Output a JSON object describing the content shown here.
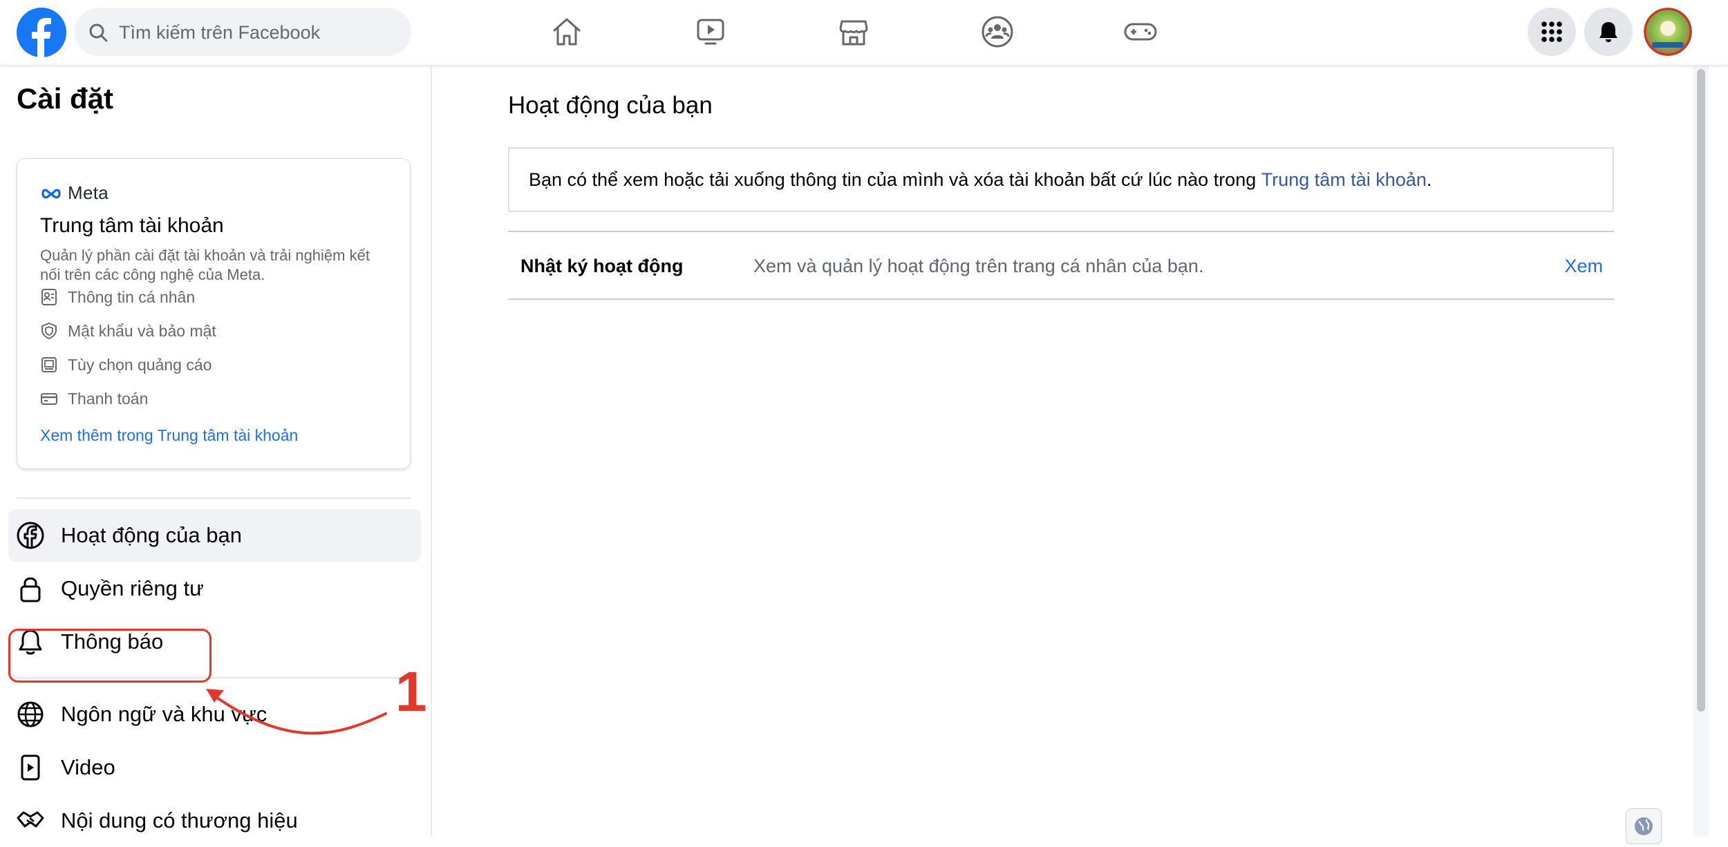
{
  "colors": {
    "facebook_blue": "#1877F2",
    "link_blue": "#216FDB",
    "annotation_red": "#E0382D",
    "active_bg": "#F0F2F5"
  },
  "header": {
    "logo_icon": "facebook-logo-icon",
    "search": {
      "placeholder": "Tìm kiếm trên Facebook",
      "value": ""
    },
    "nav_icons": [
      "home-icon",
      "watch-icon",
      "marketplace-icon",
      "groups-icon",
      "gaming-icon"
    ],
    "right_icons": [
      "menu-grid-icon",
      "notifications-bell-icon",
      "avatar"
    ]
  },
  "sidebar": {
    "title": "Cài đặt",
    "meta_card": {
      "brand": "Meta",
      "title": "Trung tâm tài khoản",
      "description": "Quản lý phần cài đặt tài khoản và trải nghiệm kết nối trên các công nghệ của Meta.",
      "items": [
        {
          "label": "Thông tin cá nhân",
          "icon": "id-card-icon"
        },
        {
          "label": "Mật khẩu và bảo mật",
          "icon": "shield-icon"
        },
        {
          "label": "Tùy chọn quảng cáo",
          "icon": "ad-display-icon"
        },
        {
          "label": "Thanh toán",
          "icon": "credit-card-icon"
        }
      ],
      "more_link": "Xem thêm trong Trung tâm tài khoản"
    },
    "items": [
      {
        "label": "Hoạt động của bạn",
        "icon": "facebook-circle-icon",
        "active": true
      },
      {
        "label": "Quyền riêng tư",
        "icon": "lock-icon",
        "active": false
      },
      {
        "label": "Thông báo",
        "icon": "bell-icon",
        "active": false
      },
      {
        "label": "Ngôn ngữ và khu vực",
        "icon": "globe-icon",
        "active": false
      },
      {
        "label": "Video",
        "icon": "video-icon",
        "active": false
      },
      {
        "label": "Nội dung có thương hiệu",
        "icon": "handshake-icon",
        "active": false
      }
    ],
    "annotation": {
      "number": "1",
      "target": "Quyền riêng tư"
    }
  },
  "main": {
    "title": "Hoạt động của bạn",
    "info": {
      "text": "Bạn có thể xem hoặc tải xuống thông tin của mình và xóa tài khoản bất cứ lúc nào trong ",
      "link": "Trung tâm tài khoản",
      "suffix": "."
    },
    "activity_log": {
      "label": "Nhật ký hoạt động",
      "description": "Xem và quản lý hoạt động trên trang cá nhân của bạn.",
      "action": "Xem"
    }
  }
}
